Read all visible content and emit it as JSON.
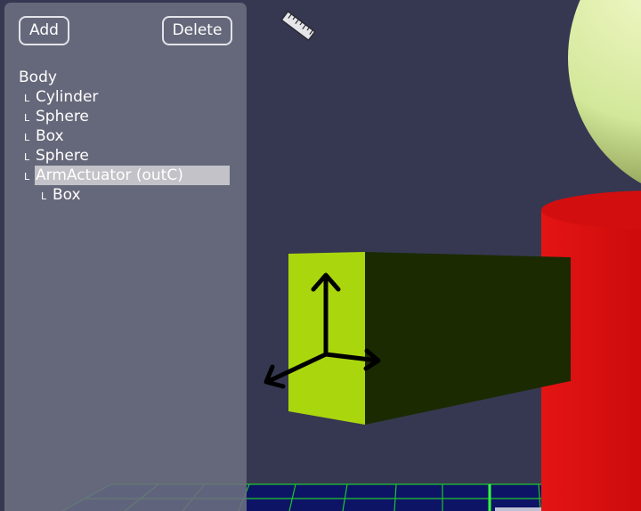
{
  "toolbar": {
    "add_label": "Add",
    "delete_label": "Delete"
  },
  "scene_tree": {
    "root": "Body",
    "items": [
      {
        "mark": "L",
        "label": "Cylinder",
        "depth": 1
      },
      {
        "mark": "L",
        "label": "Sphere",
        "depth": 1
      },
      {
        "mark": "L",
        "label": "Box",
        "depth": 1
      },
      {
        "mark": "L",
        "label": "Sphere",
        "depth": 1
      },
      {
        "mark": "L",
        "label": "ArmActuator (outC)",
        "depth": 1,
        "selected": true
      },
      {
        "mark": "L",
        "label": "Box",
        "depth": 2
      }
    ]
  },
  "viewport": {
    "background_color": "#363851",
    "icons": [
      "ruler-icon",
      "transform-gizmo-icon"
    ],
    "colors": {
      "selected_box_face": "#aad60e",
      "selected_box_side": "#1b2a00",
      "cylinder": "#d40d0d",
      "sphere": "#d6eca0",
      "grid_line": "#1fc52c",
      "grid_fill": "#0d1466"
    }
  }
}
